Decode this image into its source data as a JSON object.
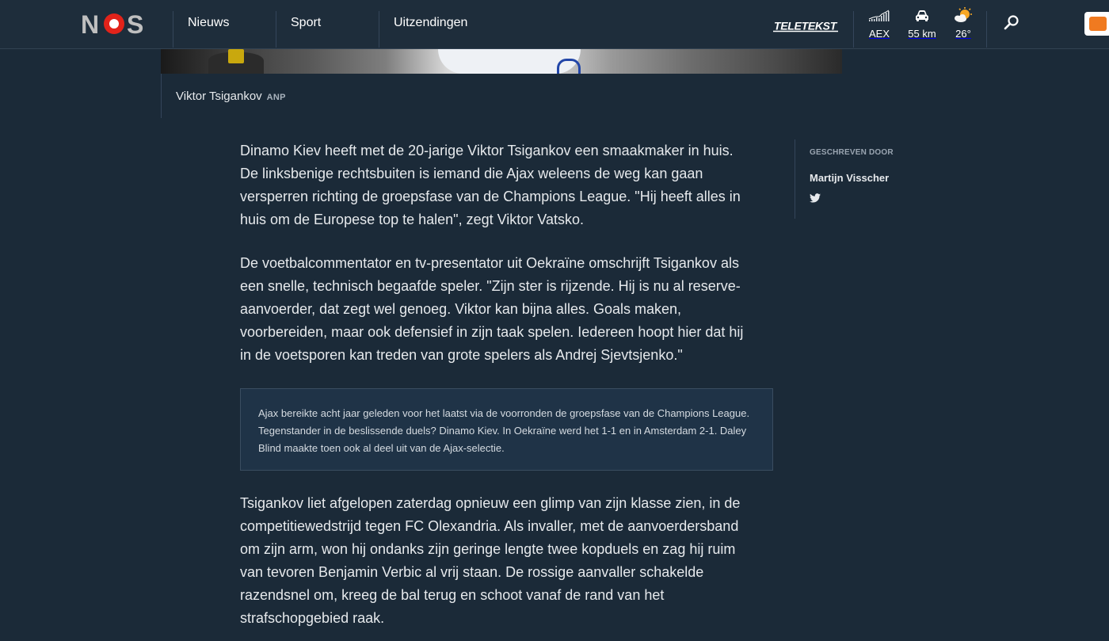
{
  "header": {
    "logo_text": "NOS",
    "nav": [
      {
        "label": "Nieuws"
      },
      {
        "label": "Sport"
      },
      {
        "label": "Uitzendingen"
      }
    ],
    "teletekst_label": "TELETEKST",
    "widgets": {
      "aex": {
        "label": "AEX",
        "icon": "chart-icon"
      },
      "traffic": {
        "label": "55 km",
        "icon": "car-icon"
      },
      "weather": {
        "label": "26°",
        "icon": "sun-cloud-icon"
      }
    },
    "search_icon": "search-icon",
    "colors": {
      "logo_red": "#e2231a",
      "logo_grey": "#bfbfbf",
      "background": "#1b2a38",
      "header": "#1e2d3b"
    }
  },
  "image": {
    "caption": "Viktor Tsigankov",
    "credit": "ANP"
  },
  "article": {
    "paragraphs": [
      "Dinamo Kiev heeft met de 20-jarige Viktor Tsigankov een smaakmaker in huis. De linksbenige rechtsbuiten is iemand die Ajax weleens de weg kan gaan versperren richting de groepsfase van de Champions League. \"Hij heeft alles in huis om de Europese top te halen\", zegt Viktor Vatsko.",
      "De voetbalcommentator en tv-presentator uit Oekraïne omschrijft Tsigankov als een snelle, technisch begaafde speler. \"Zijn ster is rijzende. Hij is nu al reserve-aanvoerder, dat zegt wel genoeg. Viktor kan bijna alles. Goals maken, voorbereiden, maar ook defensief in zijn taak spelen. Iedereen hoopt hier dat hij in de voetsporen kan treden van grote spelers als Andrej Sjevtsjenko.\"",
      "Tsigankov liet afgelopen zaterdag opnieuw een glimp van zijn klasse zien, in de competitiewedstrijd tegen FC Olexandria. Als invaller, met de aanvoerdersband om zijn arm, won hij ondanks zijn geringe lengte twee kopduels en zag hij ruim van tevoren Benjamin Verbic al vrij staan. De rossige aanvaller schakelde razendsnel om, kreeg de bal terug en schoot vanaf de rand van het strafschopgebied raak."
    ],
    "infobox": "Ajax bereikte acht jaar geleden voor het laatst via de voorronden de groepsfase van de Champions League. Tegenstander in de beslissende duels? Dinamo Kiev. In Oekraïne werd het 1-1 en in Amsterdam 2-1. Daley Blind maakte toen ook al deel uit van de Ajax-selectie."
  },
  "author": {
    "label": "GESCHREVEN DOOR",
    "name": "Martijn Visscher",
    "social_icon": "twitter-icon"
  }
}
